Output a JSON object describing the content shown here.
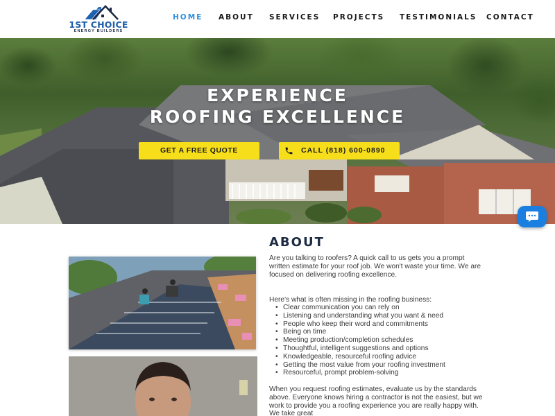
{
  "header": {
    "logo": {
      "brand": "1ST CHOICE",
      "tagline": "ENERGY BUILDERS"
    },
    "nav": [
      {
        "label": "HOME",
        "active": true
      },
      {
        "label": "ABOUT",
        "active": false
      },
      {
        "label": "SERVICES",
        "active": false
      },
      {
        "label": "PROJECTS",
        "active": false
      },
      {
        "label": "TESTIMONIALS",
        "active": false
      },
      {
        "label": "CONTACT",
        "active": false
      }
    ]
  },
  "hero": {
    "title_line1": "EXPERIENCE",
    "title_line2": "ROOFING EXCELLENCE",
    "quote_button": "GET A FREE QUOTE",
    "call_button": "CALL  (818) 600-0890",
    "call_icon": "phone-icon",
    "chat_icon": "chat-bubble-icon"
  },
  "about": {
    "title": "ABOUT",
    "intro": "Are you talking to roofers?  A quick call to us gets you a prompt written estimate for your roof job.  We won't waste your time.  We are focused on delivering roofing excellence.",
    "list_heading": "Here's what is often missing in the roofing business:",
    "list": [
      "Clear communication you can rely on",
      "Listening and understanding what you want & need",
      "People who keep their word and commitments",
      "Being on time",
      "Meeting production/completion schedules",
      "Thoughtful, intelligent suggestions and options",
      "Knowledgeable, resourceful roofing advice",
      "Getting the most value from your roofing investment",
      "Resourceful, prompt problem-solving"
    ],
    "closing": "When you request roofing estimates, evaluate us by the standards above. Everyone knows hiring a contractor is not the easiest, but we work to provide you a roofing experience you are really happy with.   We take great"
  },
  "colors": {
    "accent_blue": "#2f8fe0",
    "button_yellow": "#f7de1a",
    "heading_navy": "#1d2a44",
    "chat_blue": "#1a7fe0"
  }
}
